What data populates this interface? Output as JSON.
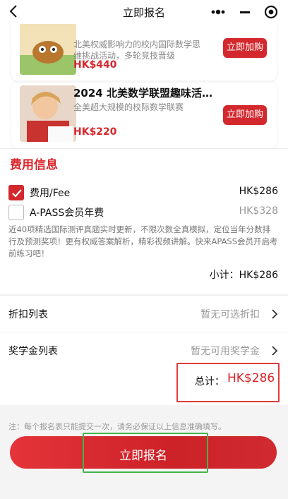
{
  "header": {
    "title": "立即报名",
    "icons": [
      "back-icon",
      "more-icon",
      "minimize-icon",
      "close-icon"
    ]
  },
  "products": [
    {
      "title": "",
      "desc_line1": "北美权威影响力的校内国际数学思",
      "desc_line2": "维挑战活动，多轮竞技晋级",
      "price": "HK$440",
      "buy_label": "立即加购"
    },
    {
      "title": "2024 北美数学联盟趣味活…",
      "desc": "全美超大规模的校际数学联赛",
      "price": "HK$220",
      "buy_label": "立即加购"
    }
  ],
  "fees": {
    "section_title": "费用信息",
    "items": [
      {
        "label": "费用/Fee",
        "price": "HK$286",
        "checked": true
      },
      {
        "label": "A-PASS会员年费",
        "price": "HK$328",
        "checked": false
      }
    ],
    "description": "近40项精选国际测评真题实时更新，不限次数全真模拟，定位当年分数排行及预测奖项！更有权威答案解析，精彩视频讲解。快来APASS会员开启考前练习吧！",
    "subtotal": "小计：HK$286"
  },
  "discount": {
    "label": "折扣列表",
    "value": "暂无可选折扣"
  },
  "scholarship": {
    "label": "奖学金列表",
    "value": "暂无可用奖学金"
  },
  "total": {
    "label": "总计：",
    "value": "HK$286"
  },
  "notice": "注：每个报名表只能提交一次，请务必保证以上信息准确填写。",
  "submit_label": "立即报名",
  "colors": {
    "accent": "#d3282d",
    "highlight_red": "#e23b3b",
    "highlight_green": "#42b54a"
  }
}
